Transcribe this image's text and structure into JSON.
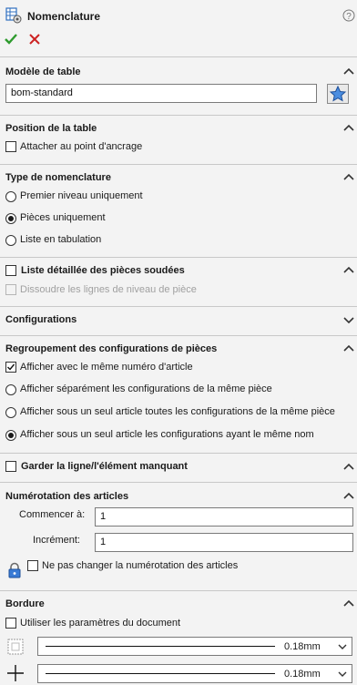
{
  "window": {
    "title": "Nomenclature"
  },
  "actions": {
    "ok": "✓",
    "cancel": "✕"
  },
  "table_template": {
    "header": "Modèle de table",
    "value": "bom-standard"
  },
  "table_position": {
    "header": "Position de la table",
    "attach_label": "Attacher au point d'ancrage",
    "attach_checked": false
  },
  "bom_type": {
    "header": "Type de nomenclature",
    "options": [
      {
        "label": "Premier niveau uniquement",
        "selected": false
      },
      {
        "label": "Pièces uniquement",
        "selected": true
      },
      {
        "label": "Liste en tabulation",
        "selected": false
      }
    ]
  },
  "weldment": {
    "header": "Liste détaillée des pièces soudées",
    "checked": false,
    "dissolve_label": "Dissoudre les lignes de niveau de pièce"
  },
  "configurations": {
    "header": "Configurations"
  },
  "grouping": {
    "header": "Regroupement des configurations de pièces",
    "option1_label": "Afficher avec le même numéro d'article",
    "option1_checked": true,
    "radios": [
      {
        "label": "Afficher séparément les configurations de la même pièce",
        "selected": false
      },
      {
        "label": "Afficher sous un seul article toutes les configurations de la même pièce",
        "selected": false
      },
      {
        "label": "Afficher sous un seul article les configurations ayant le même nom",
        "selected": true
      }
    ]
  },
  "keep_missing": {
    "header": "Garder la ligne/l'élément manquant",
    "checked": false
  },
  "numbering": {
    "header": "Numérotation des articles",
    "start_label": "Commencer à:",
    "start_value": "1",
    "increment_label": "Incrément:",
    "increment_value": "1",
    "no_change_label": "Ne pas changer la numérotation des articles"
  },
  "border": {
    "header": "Bordure",
    "use_doc_label": "Utiliser les paramètres du document",
    "box_thickness": "0.18mm",
    "grid_thickness": "0.18mm"
  },
  "colors": {
    "ok": "#2e9b2e",
    "cancel": "#cc2222",
    "accent": "#2f6fbf"
  }
}
